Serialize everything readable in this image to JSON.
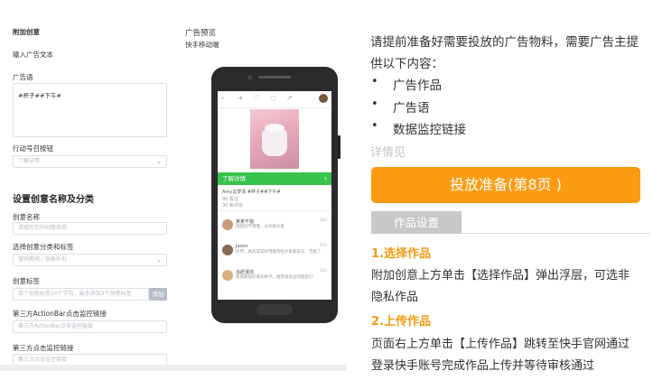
{
  "form": {
    "append_title": "附加创意",
    "input_ad_text_label": "输入广告文本",
    "ad_copy_label": "广告语",
    "ad_copy_value": "#杯子##下午#",
    "action_button_label": "行动号召按钮",
    "action_button_value": "了解详情",
    "settings_title": "设置创意名称及分类",
    "creative_name_label": "创意名称",
    "creative_name_placeholder": "请填写您的创意名称",
    "category_label": "选择创意分类和标签",
    "category_value": "服饰新闻 / 鞋类折扣",
    "tags_label": "创意标签",
    "tags_placeholder": "单个创意标签10个字符，最多添加3个创意标签",
    "add_button": "添加",
    "actionbar_label": "第三方ActionBar点击监控链接",
    "actionbar_placeholder": "第三方ActionBar点击监控链接",
    "click_monitor_label": "第三方点击监控链接",
    "click_monitor_placeholder": "第三方点击监控链接"
  },
  "preview": {
    "title": "广告预览",
    "subtitle": "快手移动端",
    "green_bar_label": "了解详情",
    "post_line": "Amy云梦泽 #杯子##下午#",
    "post_meta_1": "90 看过",
    "post_meta_2": "30 条评论",
    "comments": [
      {
        "name": "某某不错",
        "time": "12s",
        "text": "搭配的不错哦，分享给大家"
      },
      {
        "name": "Jason",
        "time": "12s",
        "text": "好用，真的非常好用推荐给大家都去买，无敌了"
      },
      {
        "name": "追赶潮流",
        "time": "12s",
        "text": "看着都很好看的样子，推荐给身边的朋友们"
      }
    ]
  },
  "guide": {
    "intro_line1": "请提前准备好需要投放的广告物料，需要广告主提",
    "intro_line2": "供以下内容：",
    "bullets": [
      "广告作品",
      "广告语",
      "数据监控链接"
    ],
    "more_link": "详情见",
    "cta_button": "投放准备(第8页 )",
    "tab_label": "作品设置",
    "step1_title": "1.选择作品",
    "step1_line1": "附加创意上方单击【选择作品】弹出浮层，可选非",
    "step1_line2": "隐私作品",
    "step2_title": "2.上传作品",
    "step2_line1": "页面右上方单击【上传作品】跳转至快手官网通过",
    "step2_line2": "登录快手账号完成作品上传并等待审核通过"
  },
  "colors": {
    "accent_orange": "#fb9b12",
    "heading_orange": "#f39a12",
    "green_bar": "#37c34c",
    "tab_gray": "#c8c8c8"
  }
}
